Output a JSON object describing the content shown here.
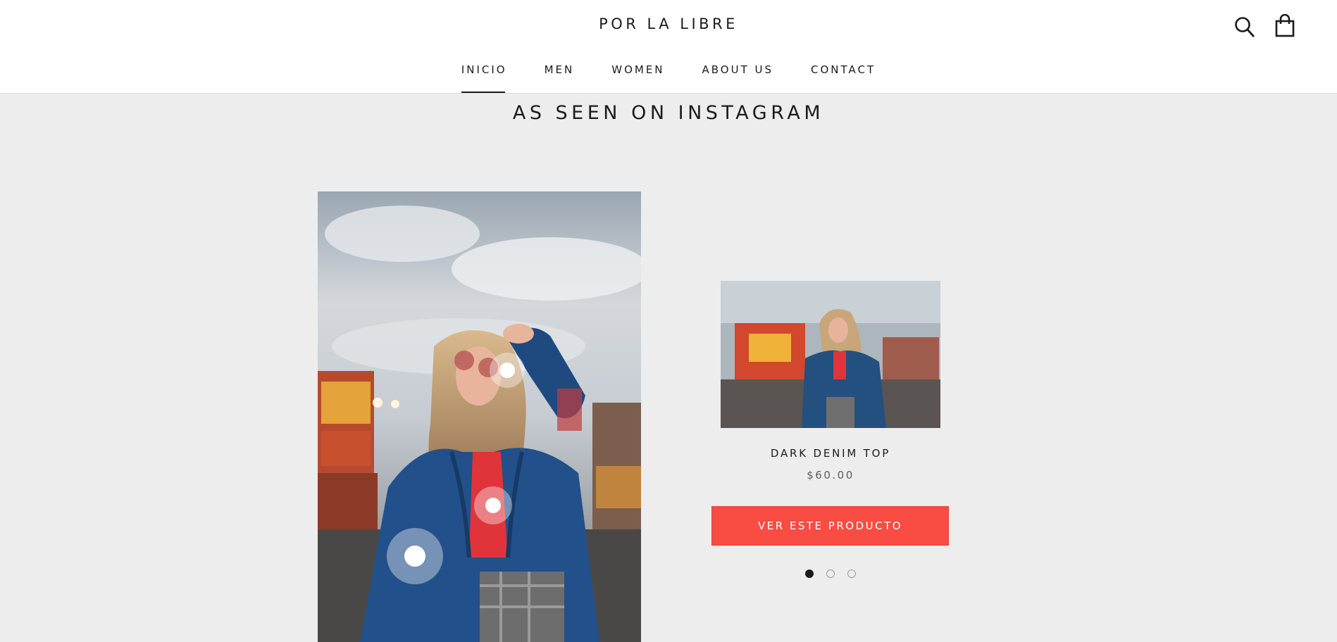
{
  "header": {
    "logo": "POR LA LIBRE",
    "nav": [
      "INICIO",
      "MEN",
      "WOMEN",
      "ABOUT US",
      "CONTACT"
    ],
    "active_nav": "INICIO",
    "icons": [
      "search-icon",
      "cart-icon"
    ]
  },
  "section": {
    "title": "AS SEEN ON INSTAGRAM"
  },
  "product": {
    "name": "DARK DENIM TOP",
    "price": "$60.00",
    "cta_label": "VER ESTE PRODUCTO"
  },
  "slider": {
    "count": 3,
    "active_index": 0
  },
  "colors": {
    "accent": "#f94c43",
    "background": "#ededed",
    "text": "#1c1b1b"
  }
}
